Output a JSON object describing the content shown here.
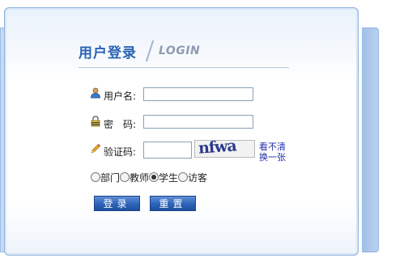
{
  "header": {
    "title_cn": "用户登录",
    "title_en": "LOGIN"
  },
  "form": {
    "username": {
      "label": "用户名:",
      "value": "",
      "icon": "user-icon"
    },
    "password": {
      "label": "密　码:",
      "value": "",
      "icon": "lock-icon"
    },
    "captcha": {
      "label": "验证码:",
      "value": "",
      "icon": "pencil-icon",
      "image_text": "nfwa",
      "refresh_line1": "看不清",
      "refresh_line2": "换一张"
    },
    "roles": [
      {
        "label": "部门",
        "checked": false
      },
      {
        "label": "教师",
        "checked": false
      },
      {
        "label": "学生",
        "checked": true
      },
      {
        "label": "访客",
        "checked": false
      }
    ]
  },
  "buttons": {
    "login": "登录",
    "reset": "重置"
  },
  "colors": {
    "accent": "#2a63b3",
    "button": "#2d63b8",
    "link": "#1f2fa8"
  }
}
